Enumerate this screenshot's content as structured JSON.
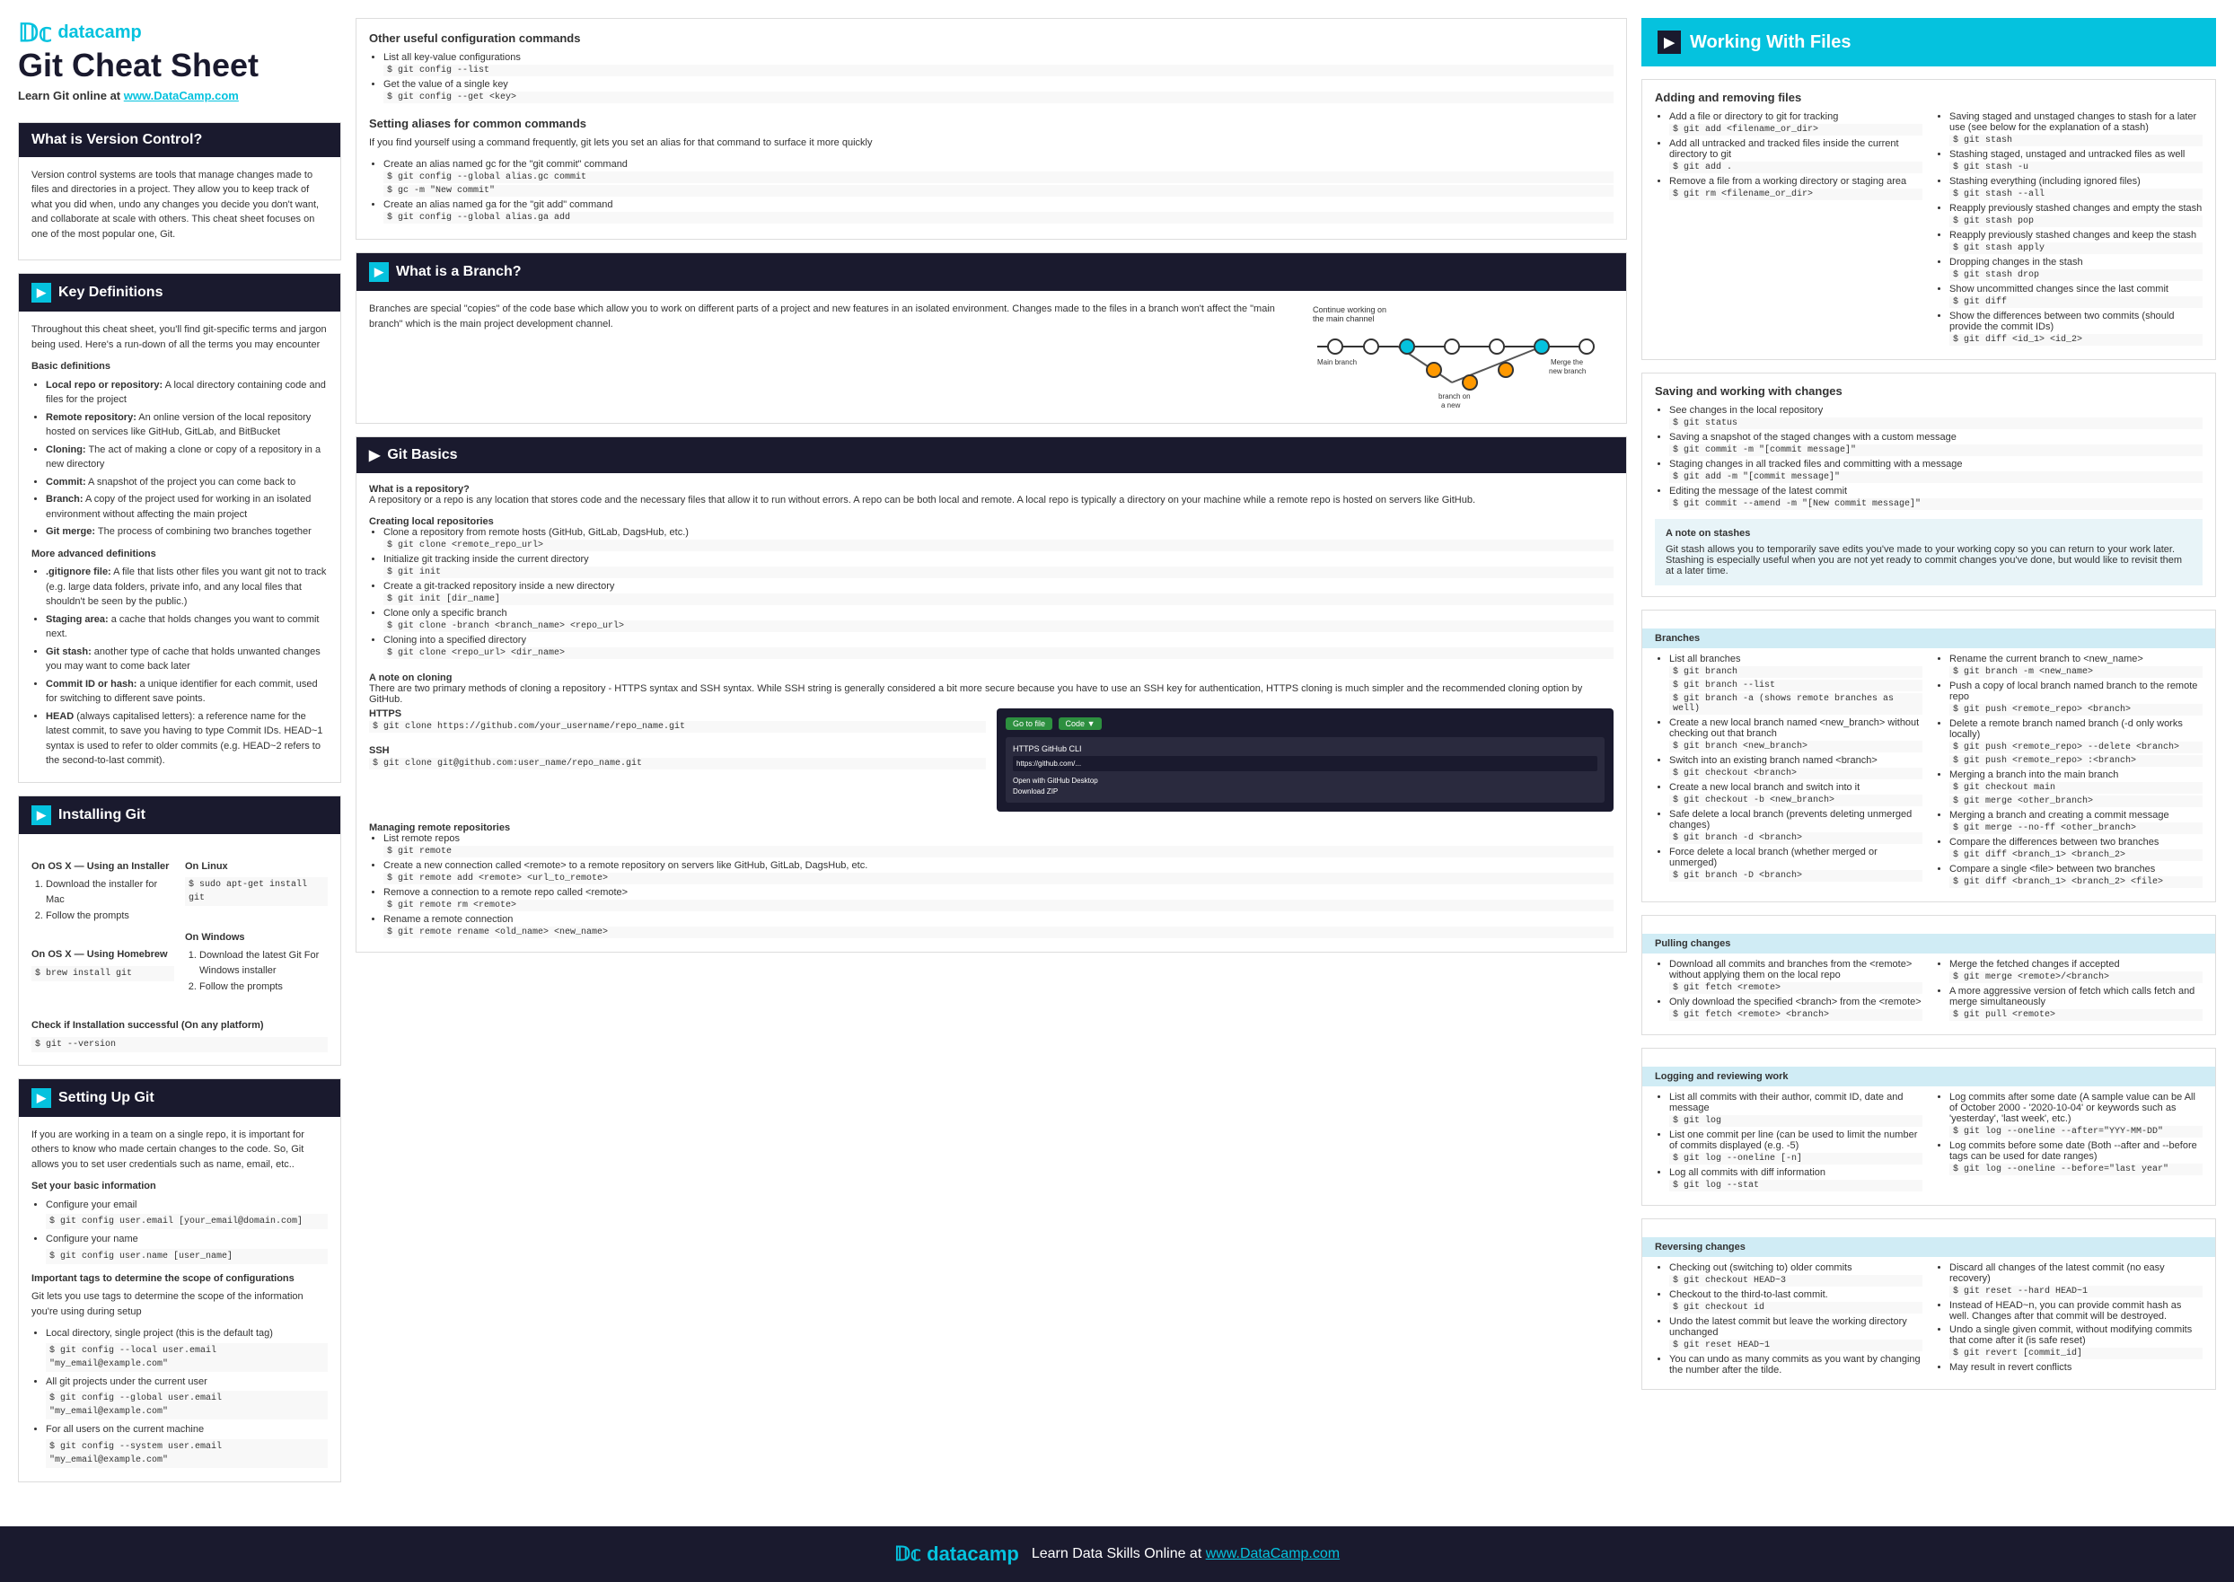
{
  "page": {
    "background": "#f5f5f5"
  },
  "header": {
    "logo": "datacamp",
    "title": "Git Cheat Sheet",
    "subtitle": "Learn Git online at www.DataCamp.com"
  },
  "sections": {
    "version_control": {
      "title": "What is Version Control?",
      "body": "Version control systems are tools that manage changes made to files and directories in a project. They allow you to keep track of what you did when, undo any changes you decide you don't want, and collaborate at scale with others. This cheat sheet focuses on one of the most popular one, Git."
    },
    "key_definitions": {
      "title": "Key Definitions",
      "intro": "Throughout this cheat sheet, you'll find git-specific terms and jargon being used. Here's a run-down of all the terms you may encounter",
      "basic": {
        "title": "Basic definitions",
        "items": [
          "Local repo or repository: A local directory containing code and files for the project",
          "Remote repository: An online version of the local repository hosted on services like GitHub, GitLab, and BitBucket",
          "Cloning: The act of making a clone or copy of a repository in a new directory",
          "Commit: A snapshot of the project you can come back to",
          "Branch: A copy of the project used for working in an isolated environment without affecting the main project",
          "Git merge: The process of combining two branches together"
        ]
      },
      "advanced": {
        "title": "More advanced definitions",
        "items": [
          ".gitignore file: A file that lists other files you want git not to track (e.g. large data folders, private info, and any local files that shouldn't be seen by the public.)",
          "Staging area: a cache that holds changes you want to commit next.",
          "Git stash: another type of cache that holds unwanted changes you may want to come back later",
          "Commit ID or hash: a unique identifier for each commit, used for switching to different save points.",
          "HEAD (always capitalised letters): a reference name for the latest commit, to save you having to type Commit IDs. HEAD~1 syntax is used to refer to older commits (e.g. HEAD~2 refers to the second-to-last commit)."
        ]
      }
    },
    "installing_git": {
      "title": "Installing Git",
      "osx_installer": {
        "title": "On OS X — Using an Installer",
        "steps": [
          "Download the installer for Mac",
          "Follow the prompts"
        ]
      },
      "osx_homebrew": {
        "title": "On OS X — Using Homebrew",
        "code": "$ brew install git"
      },
      "linux": {
        "title": "On Linux",
        "code": "$ sudo apt-get install git"
      },
      "windows": {
        "title": "On Windows",
        "steps": [
          "Download the latest Git For Windows installer",
          "Follow the prompts"
        ]
      },
      "check": {
        "title": "Check if Installation successful (On any platform)",
        "code": "$ git --version"
      }
    },
    "setting_up_git": {
      "title": "Setting Up Git",
      "intro": "If you are working in a team on a single repo, it is important for others to know who made certain changes to the code. So, Git allows you to set user credentials such as name, email, etc..",
      "basic_info": {
        "title": "Set your basic information",
        "items": [
          "Configure your email",
          "$ git config user.email [your_email@domain.com]",
          "Configure your name",
          "$ git config user.name [user_name]"
        ]
      },
      "scope": {
        "title": "Important tags to determine the scope of configurations",
        "intro": "Git lets you use tags to determine the scope of the information you're using during setup",
        "items": [
          "Local directory, single project (this is the default tag)",
          "$ git config --local user.email \"my_email@example.com\"",
          "All git projects under the current user",
          "$ git config --global user.email \"my_email@example.com\"",
          "For all users on the current machine",
          "$ git config --system user.email \"my_email@example.com\""
        ]
      }
    },
    "config_commands": {
      "title": "Other useful configuration commands",
      "items": [
        "List all key-value configurations",
        "$ git config --list",
        "Get the value of a single key",
        "$ git config --get <key>"
      ],
      "aliases": {
        "title": "Setting aliases for common commands",
        "intro": "If you find yourself using a command frequently, git lets you set an alias for that command to surface it more quickly",
        "items": [
          "Create an alias named gc for the \"git commit\" command",
          "$ git config --global alias.gc commit",
          "$ gc -m \"New commit\"",
          "Create an alias named ga for the \"git add\" command",
          "$ git config --global alias.ga add"
        ]
      }
    },
    "branch": {
      "title": "What is a Branch?",
      "body": "Branches are special \"copies\" of the code base which allow you to work on different parts of a project and new features in an isolated environment. Changes made to the files in a branch won't affect the \"main branch\" which is the main project development channel."
    },
    "git_basics": {
      "title": "Git Basics",
      "what_is_repo": {
        "title": "What is a repository?",
        "body": "A repository or a repo is any location that stores code and the necessary files that allow it to run without errors. A repo can be both local and remote. A local repo is typically a directory on your machine while a remote repo is hosted on servers like GitHub."
      },
      "creating_local": {
        "title": "Creating local repositories",
        "items": [
          "Clone a repository from remote hosts (GitHub, GitLab, DagsHub, etc.)",
          "$ git clone <remote_repo_url>",
          "Initialize git tracking inside the current directory",
          "$ git init",
          "Create a git-tracked repository inside a new directory",
          "$ git init [dir_name]",
          "Clone only a specific branch",
          "$ git clone -branch <branch_name> <repo_url>",
          "Cloning into a specified directory",
          "$ git clone <repo_url> <dir_name>"
        ]
      },
      "cloning_note": {
        "title": "A note on cloning",
        "body": "There are two primary methods of cloning a repository - HTTPS syntax and SSH syntax. While SSH string is generally considered a bit more secure because you have to use an SSH key for authentication, HTTPS cloning is much simpler and the recommended cloning option by GitHub.",
        "https_title": "HTTPS",
        "https_code": "$ git clone https://github.com/your_username/repo_name.git",
        "ssh_title": "SSH",
        "ssh_code": "$ git clone git@github.com:user_name/repo_name.git"
      },
      "managing_remote": {
        "title": "Managing remote repositories",
        "items": [
          "List remote repos",
          "$ git remote",
          "Create a new connection called <remote> to a remote repository on servers like GitHub, GitLab, DagsHub, etc.",
          "$ git remote add <remote> <url_to_remote>",
          "Remove a connection to a remote repo called <remote>",
          "$ git remote rm <remote>",
          "Rename a remote connection",
          "$ git remote rename <old_name> <new_name>"
        ]
      }
    },
    "working_with_files": {
      "title": "Working With Files",
      "adding_removing": {
        "title": "Adding and removing files",
        "left_items": [
          "Add a file or directory to git for tracking",
          "$ git add <filename_or_dir>",
          "Add all untracked and tracked files inside the current directory to git",
          "$ git add .",
          "Remove a file from a working directory or staging area",
          "$ git rm <filename_or_dir>"
        ],
        "right_items": [
          "Saving staged and unstaged changes to stash for a later use (see below for the explanation of a stash)",
          "$ git stash",
          "Stashing staged, unstaged and untracked files as well",
          "$ git stash -u",
          "Stashing everything (including ignored files)",
          "$ git stash --all",
          "Reapply previously stashed changes and empty the stash",
          "$ git stash pop",
          "Reapply previously stashed changes and keep the stash",
          "$ git stash apply",
          "Dropping changes in the stash",
          "$ git stash drop",
          "Show uncommitted changes since the last commit",
          "$ git diff",
          "Show the differences between two commits (should provide the commit IDs)",
          "$ git diff <id_1> <id_2>"
        ]
      },
      "saving_changes": {
        "title": "Saving and working with changes",
        "left_items": [
          "See changes in the local repository",
          "$ git status",
          "Saving a snapshot of the staged changes with a custom message",
          "$ git commit -m \"[commit message]\"",
          "Staging changes in all tracked files and committing with a message",
          "$ git add -m \"[commit message]\"",
          "Editing the message of the latest commit",
          "$ git commit --amend -m \"[New commit message]\""
        ]
      },
      "stash_note": {
        "title": "A note on stashes",
        "body": "Git stash allows you to temporarily save edits you've made to your working copy so you can return to your work later. Stashing is especially useful when you are not yet ready to commit changes you've done, but would like to revisit them at a later time."
      },
      "branches": {
        "title": "Branches",
        "left_items": [
          "List all branches",
          "$ git branch",
          "$ git branch --list",
          "$ git branch -a  (shows remote branches as well)",
          "Create a new local branch named <new_branch> without checking out that branch",
          "$ git branch <new_branch>",
          "Switch into an existing branch named <branch>",
          "$ git checkout <branch>",
          "Create a new local branch and switch into it",
          "$ git checkout -b <new_branch>",
          "Safe delete a local branch (prevents deleting unmerged changes)",
          "$ git branch -d <branch>",
          "Force delete a local branch (whether merged or unmerged)",
          "$ git branch -D <branch>"
        ],
        "right_items": [
          "Rename the current branch to <new_name>",
          "$ git branch -m <new_name>",
          "Push a copy of local branch named branch to the remote repo",
          "$ git push <remote_repo> <branch>",
          "Delete a remote branch named branch (-d only works locally)",
          "$ git push <remote_repo> --delete <branch>",
          "$ git push <remote_repo> :<branch>",
          "Merging a branch into the main branch",
          "$ git checkout main",
          "$ git merge <other_branch>",
          "Merging a branch and creating a commit message",
          "$ git merge --no-ff <other_branch>",
          "Compare the differences between two branches",
          "$ git diff <branch_1> <branch_2>",
          "Compare a single <file> between two branches",
          "$ git diff <branch_1> <branch_2> <file>"
        ]
      },
      "pulling": {
        "title": "Pulling changes",
        "left_items": [
          "Download all commits and branches from the <remote> without applying them on the local repo",
          "$ git fetch <remote>",
          "Only download the specified <branch> from the <remote>",
          "$ git fetch <remote> <branch>"
        ],
        "right_items": [
          "Merge the fetched changes if accepted",
          "$ git merge <remote>/<branch>",
          "A more aggressive version of fetch which calls fetch and merge simultaneously",
          "$ git pull <remote>"
        ]
      },
      "logging": {
        "title": "Logging and reviewing work",
        "left_items": [
          "List all commits with their author, commit ID, date and message",
          "$ git log",
          "List one commit per line (can be used to limit the number of commits displayed (e.g. -5)",
          "$ git log --oneline [-n]",
          "Log all commits with diff information",
          "$ git log --stat"
        ],
        "right_items": [
          "Log commits after some date (A sample value can be All of October 2000 - '2020-10-04' or keywords such as 'yesterday', 'last week', etc.)",
          "$ git log --oneline --after=\"YYY-MM-DD\"",
          "Log commits before some date (Both --after and --before tags can be used for date ranges)",
          "$ git log --oneline --before=\"last year\""
        ]
      },
      "reversing": {
        "title": "Reversing changes",
        "left_items": [
          "Checking out (switching to) older commits",
          "$ git checkout HEAD~3",
          "Checkout to the third-to-last commit.",
          "$ git checkout id",
          "Undo the latest commit but leave the working directory unchanged",
          "$ git reset HEAD~1",
          "You can undo as many commits as you want by changing the number after the tilde."
        ],
        "right_items": [
          "Discard all changes of the latest commit (no easy recovery)",
          "$ git reset --hard HEAD~1",
          "Instead of HEAD~n, you can provide commit hash as well. Changes after that commit will be destroyed.",
          "Undo a single given commit, without modifying commits that come after it (is safe reset)",
          "$ git revert [commit_id]",
          "May result in revert conflicts"
        ]
      }
    },
    "footer": {
      "text": "Learn Data Skills Online at www.DataCamp.com"
    }
  }
}
